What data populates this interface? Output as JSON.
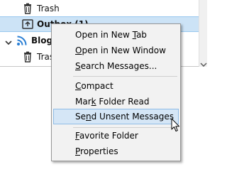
{
  "folder_tree": {
    "rows": [
      {
        "label": "Trash",
        "icon": "trash-icon"
      },
      {
        "label": "Outbox (1)",
        "icon": "outbox-icon",
        "selected": true
      },
      {
        "label": "Blogs",
        "icon": "rss-feed-icon",
        "expanded": true
      },
      {
        "label": "Trash",
        "icon": "trash-icon"
      }
    ]
  },
  "context_menu": {
    "items": [
      {
        "pre": "Open in New ",
        "key": "T",
        "post": "ab"
      },
      {
        "pre": "",
        "key": "O",
        "post": "pen in New Window"
      },
      {
        "pre": "",
        "key": "S",
        "post": "earch Messages..."
      },
      {
        "pre": "",
        "key": "C",
        "post": "ompact"
      },
      {
        "pre": "Mar",
        "key": "k",
        "post": " Folder Read"
      },
      {
        "pre": "Se",
        "key": "n",
        "post": "d Unsent Messages"
      },
      {
        "pre": "",
        "key": "F",
        "post": "avorite Folder"
      },
      {
        "pre": "",
        "key": "P",
        "post": "roperties"
      }
    ],
    "highlighted_item": "Send Unsent Messages"
  },
  "colors": {
    "selection_bg": "#cce3f6",
    "menu_bg": "#f2f2f2",
    "menu_highlight": "#d5e6f6",
    "rss_orange": "#f58220"
  }
}
